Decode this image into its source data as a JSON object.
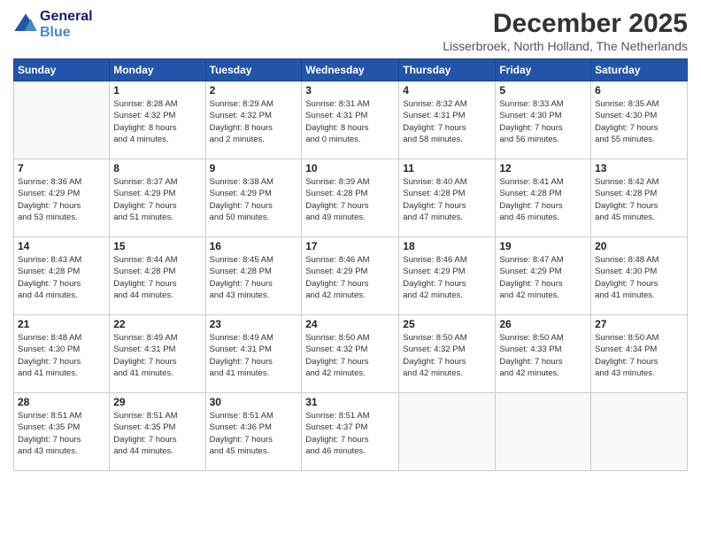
{
  "header": {
    "logo_line1": "General",
    "logo_line2": "Blue",
    "month": "December 2025",
    "location": "Lisserbroek, North Holland, The Netherlands"
  },
  "weekdays": [
    "Sunday",
    "Monday",
    "Tuesday",
    "Wednesday",
    "Thursday",
    "Friday",
    "Saturday"
  ],
  "weeks": [
    [
      {
        "day": "",
        "info": ""
      },
      {
        "day": "1",
        "info": "Sunrise: 8:28 AM\nSunset: 4:32 PM\nDaylight: 8 hours\nand 4 minutes."
      },
      {
        "day": "2",
        "info": "Sunrise: 8:29 AM\nSunset: 4:32 PM\nDaylight: 8 hours\nand 2 minutes."
      },
      {
        "day": "3",
        "info": "Sunrise: 8:31 AM\nSunset: 4:31 PM\nDaylight: 8 hours\nand 0 minutes."
      },
      {
        "day": "4",
        "info": "Sunrise: 8:32 AM\nSunset: 4:31 PM\nDaylight: 7 hours\nand 58 minutes."
      },
      {
        "day": "5",
        "info": "Sunrise: 8:33 AM\nSunset: 4:30 PM\nDaylight: 7 hours\nand 56 minutes."
      },
      {
        "day": "6",
        "info": "Sunrise: 8:35 AM\nSunset: 4:30 PM\nDaylight: 7 hours\nand 55 minutes."
      }
    ],
    [
      {
        "day": "7",
        "info": "Sunrise: 8:36 AM\nSunset: 4:29 PM\nDaylight: 7 hours\nand 53 minutes."
      },
      {
        "day": "8",
        "info": "Sunrise: 8:37 AM\nSunset: 4:29 PM\nDaylight: 7 hours\nand 51 minutes."
      },
      {
        "day": "9",
        "info": "Sunrise: 8:38 AM\nSunset: 4:29 PM\nDaylight: 7 hours\nand 50 minutes."
      },
      {
        "day": "10",
        "info": "Sunrise: 8:39 AM\nSunset: 4:28 PM\nDaylight: 7 hours\nand 49 minutes."
      },
      {
        "day": "11",
        "info": "Sunrise: 8:40 AM\nSunset: 4:28 PM\nDaylight: 7 hours\nand 47 minutes."
      },
      {
        "day": "12",
        "info": "Sunrise: 8:41 AM\nSunset: 4:28 PM\nDaylight: 7 hours\nand 46 minutes."
      },
      {
        "day": "13",
        "info": "Sunrise: 8:42 AM\nSunset: 4:28 PM\nDaylight: 7 hours\nand 45 minutes."
      }
    ],
    [
      {
        "day": "14",
        "info": "Sunrise: 8:43 AM\nSunset: 4:28 PM\nDaylight: 7 hours\nand 44 minutes."
      },
      {
        "day": "15",
        "info": "Sunrise: 8:44 AM\nSunset: 4:28 PM\nDaylight: 7 hours\nand 44 minutes."
      },
      {
        "day": "16",
        "info": "Sunrise: 8:45 AM\nSunset: 4:28 PM\nDaylight: 7 hours\nand 43 minutes."
      },
      {
        "day": "17",
        "info": "Sunrise: 8:46 AM\nSunset: 4:29 PM\nDaylight: 7 hours\nand 42 minutes."
      },
      {
        "day": "18",
        "info": "Sunrise: 8:46 AM\nSunset: 4:29 PM\nDaylight: 7 hours\nand 42 minutes."
      },
      {
        "day": "19",
        "info": "Sunrise: 8:47 AM\nSunset: 4:29 PM\nDaylight: 7 hours\nand 42 minutes."
      },
      {
        "day": "20",
        "info": "Sunrise: 8:48 AM\nSunset: 4:30 PM\nDaylight: 7 hours\nand 41 minutes."
      }
    ],
    [
      {
        "day": "21",
        "info": "Sunrise: 8:48 AM\nSunset: 4:30 PM\nDaylight: 7 hours\nand 41 minutes."
      },
      {
        "day": "22",
        "info": "Sunrise: 8:49 AM\nSunset: 4:31 PM\nDaylight: 7 hours\nand 41 minutes."
      },
      {
        "day": "23",
        "info": "Sunrise: 8:49 AM\nSunset: 4:31 PM\nDaylight: 7 hours\nand 41 minutes."
      },
      {
        "day": "24",
        "info": "Sunrise: 8:50 AM\nSunset: 4:32 PM\nDaylight: 7 hours\nand 42 minutes."
      },
      {
        "day": "25",
        "info": "Sunrise: 8:50 AM\nSunset: 4:32 PM\nDaylight: 7 hours\nand 42 minutes."
      },
      {
        "day": "26",
        "info": "Sunrise: 8:50 AM\nSunset: 4:33 PM\nDaylight: 7 hours\nand 42 minutes."
      },
      {
        "day": "27",
        "info": "Sunrise: 8:50 AM\nSunset: 4:34 PM\nDaylight: 7 hours\nand 43 minutes."
      }
    ],
    [
      {
        "day": "28",
        "info": "Sunrise: 8:51 AM\nSunset: 4:35 PM\nDaylight: 7 hours\nand 43 minutes."
      },
      {
        "day": "29",
        "info": "Sunrise: 8:51 AM\nSunset: 4:35 PM\nDaylight: 7 hours\nand 44 minutes."
      },
      {
        "day": "30",
        "info": "Sunrise: 8:51 AM\nSunset: 4:36 PM\nDaylight: 7 hours\nand 45 minutes."
      },
      {
        "day": "31",
        "info": "Sunrise: 8:51 AM\nSunset: 4:37 PM\nDaylight: 7 hours\nand 46 minutes."
      },
      {
        "day": "",
        "info": ""
      },
      {
        "day": "",
        "info": ""
      },
      {
        "day": "",
        "info": ""
      }
    ]
  ]
}
